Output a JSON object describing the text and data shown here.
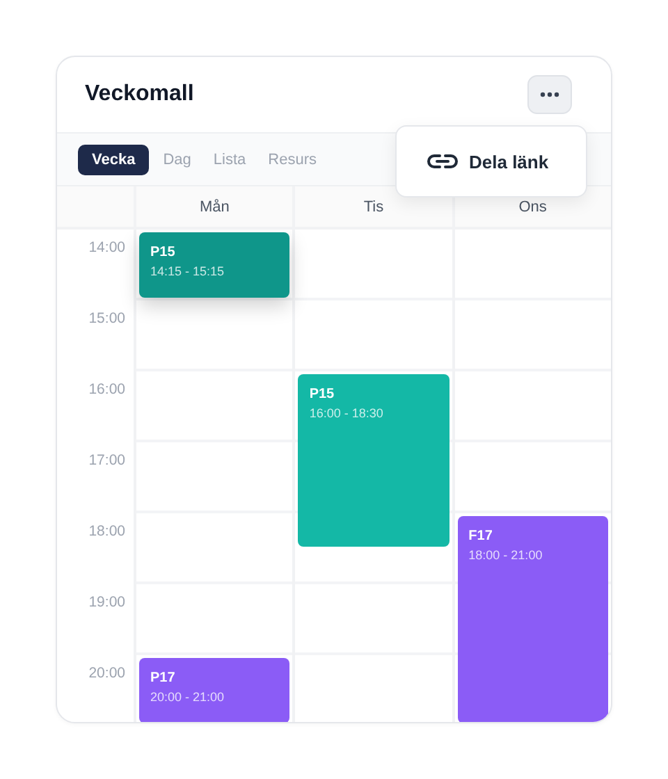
{
  "header": {
    "title": "Veckomall"
  },
  "menu": {
    "items": [
      {
        "label": "Dela länk",
        "kind": "link"
      }
    ]
  },
  "tabs": [
    {
      "label": "Vecka",
      "selected": true
    },
    {
      "label": "Dag",
      "selected": false
    },
    {
      "label": "Lista",
      "selected": false
    },
    {
      "label": "Resurs",
      "selected": false
    }
  ],
  "times": [
    "14:00",
    "15:00",
    "16:00",
    "17:00",
    "18:00",
    "19:00",
    "20:00"
  ],
  "days": [
    {
      "label": "Mån",
      "events": [
        {
          "title": "P15",
          "time": "14:15 - 15:15",
          "color": "#0f968a",
          "dragging": true
        },
        {
          "title": "P17",
          "time": "20:00 - 21:00",
          "color": "#8b5cf6",
          "dragging": false
        }
      ]
    },
    {
      "label": "Tis",
      "events": [
        {
          "title": "P15",
          "time": "16:00 - 18:30",
          "color": "#14b8a6",
          "dragging": false
        }
      ]
    },
    {
      "label": "Ons",
      "events": [
        {
          "title": "F17",
          "time": "18:00 - 21:00",
          "color": "#8b5cf6",
          "dragging": false
        }
      ]
    }
  ]
}
